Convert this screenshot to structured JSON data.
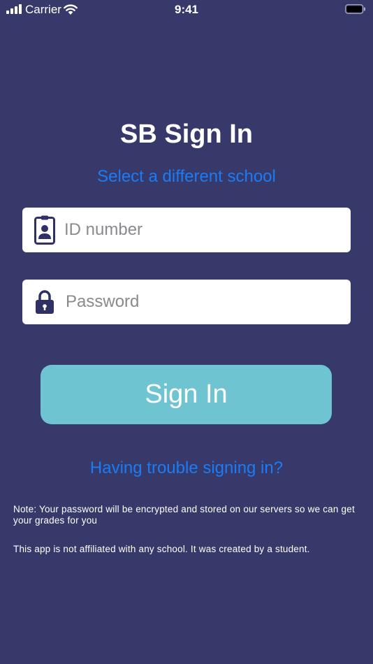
{
  "status_bar": {
    "carrier": "Carrier",
    "time": "9:41"
  },
  "title": "SB Sign In",
  "select_school_link": "Select a different school",
  "id_field": {
    "value": "",
    "placeholder": "ID number",
    "icon": "id-badge-icon"
  },
  "password_field": {
    "value": "",
    "placeholder": "Password",
    "icon": "lock-icon"
  },
  "signin_button_label": "Sign In",
  "trouble_link": "Having trouble signing in?",
  "notes": {
    "encryption": "Note: Your password will be encrypted and stored on our servers so we can get your grades for you",
    "affiliation": "This app is not affiliated with any school. It was created by a student."
  },
  "colors": {
    "background": "#38396b",
    "link": "#1a7cf5",
    "button": "#6fc4d1",
    "icon": "#2f3166"
  }
}
